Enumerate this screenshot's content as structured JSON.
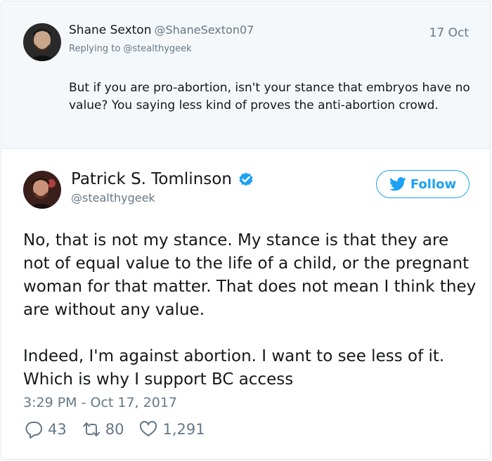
{
  "colors": {
    "accent": "#1da1f2",
    "text": "#14171a",
    "muted": "#657786",
    "reply_bg": "#f5f8fa"
  },
  "reply_tweet": {
    "avatar_icon": "avatar-shane",
    "name": "Shane Sexton",
    "handle": "@ShaneSexton07",
    "date": "17 Oct",
    "replying_to": "Replying to @stealthygeek",
    "text": "But if you are pro-abortion, isn't your stance that embryos have no value? You saying less kind of proves the anti-abortion crowd."
  },
  "main_tweet": {
    "avatar_icon": "avatar-patrick",
    "name": "Patrick S. Tomlinson",
    "verified_icon": "verified-badge-icon",
    "handle": "@stealthygeek",
    "follow_label": "Follow",
    "paragraphs": [
      "No, that is not my stance. My stance is that they are not of equal value to the life of a child, or the pregnant woman for that matter. That does not mean I think they are without any value.",
      "Indeed, I'm against abortion. I want to see less of it. Which is why I support BC access"
    ],
    "timestamp": "3:29 PM - Oct 17, 2017",
    "replies": "43",
    "retweets": "80",
    "likes": "1,291"
  }
}
